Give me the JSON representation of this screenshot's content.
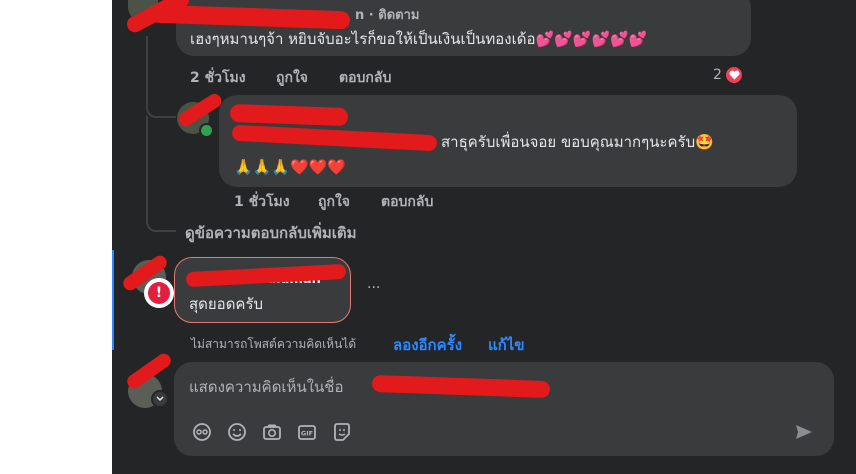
{
  "comment1": {
    "author_suffix": "n · ติดตาม",
    "text": "เฮงๆหมานๆจ้า หยิบจับอะไรก็ขอให้เป็นเงินเป็นทองเด้อ💕💕💕💕💕💕",
    "time": "2 ชั่วโมง",
    "like_label": "ถูกใจ",
    "reply_label": "ตอบกลับ",
    "reaction_count": "2"
  },
  "comment2": {
    "text_line1": "สาธุครับเพื่อนจอย ขอบคุณมากๆนะครับ🤩",
    "text_line2": "🙏🙏🙏❤️❤️❤️",
    "time": "1 ชั่วโมง",
    "like_label": "ถูกใจ",
    "reply_label": "ตอบกลับ"
  },
  "view_more_replies": "ดูข้อความตอบกลับเพิ่มเติม",
  "failed_comment": {
    "author_suffix": "Hulaman",
    "text": "สุดยอดครับ",
    "more": "···",
    "error_text": "ไม่สามารถโพสต์ความคิดเห็นได้",
    "retry_label": "ลองอีกครั้ง",
    "edit_label": "แก้ไข"
  },
  "composer": {
    "placeholder": "แสดงความคิดเห็นในชื่อ"
  },
  "colors": {
    "panel": "#242526",
    "bubble": "#3a3b3c",
    "link": "#2d88ff",
    "error": "#e41e3f",
    "redaction": "#e31a1c"
  }
}
